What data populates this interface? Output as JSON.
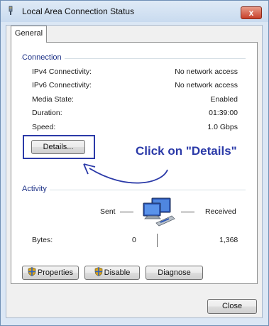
{
  "window": {
    "title": "Local Area Connection Status",
    "close_glyph": "x",
    "title_icon": "network-adapter-icon"
  },
  "tabs": [
    {
      "label": "General",
      "selected": true
    }
  ],
  "connection": {
    "group_label": "Connection",
    "rows": [
      {
        "label": "IPv4 Connectivity:",
        "value": "No network access"
      },
      {
        "label": "IPv6 Connectivity:",
        "value": "No network access"
      },
      {
        "label": "Media State:",
        "value": "Enabled"
      },
      {
        "label": "Duration:",
        "value": "01:39:00"
      },
      {
        "label": "Speed:",
        "value": "1.0 Gbps"
      }
    ],
    "details_button": "Details..."
  },
  "activity": {
    "group_label": "Activity",
    "sent_label": "Sent",
    "received_label": "Received",
    "bytes_label": "Bytes:",
    "bytes_sent": "0",
    "bytes_received": "1,368",
    "icon": "network-computers-icon"
  },
  "buttons": {
    "properties": "Properties",
    "disable": "Disable",
    "diagnose": "Diagnose",
    "close": "Close"
  },
  "annotation": {
    "text": "Click on \"Details\"",
    "color": "#2b3aa8"
  }
}
